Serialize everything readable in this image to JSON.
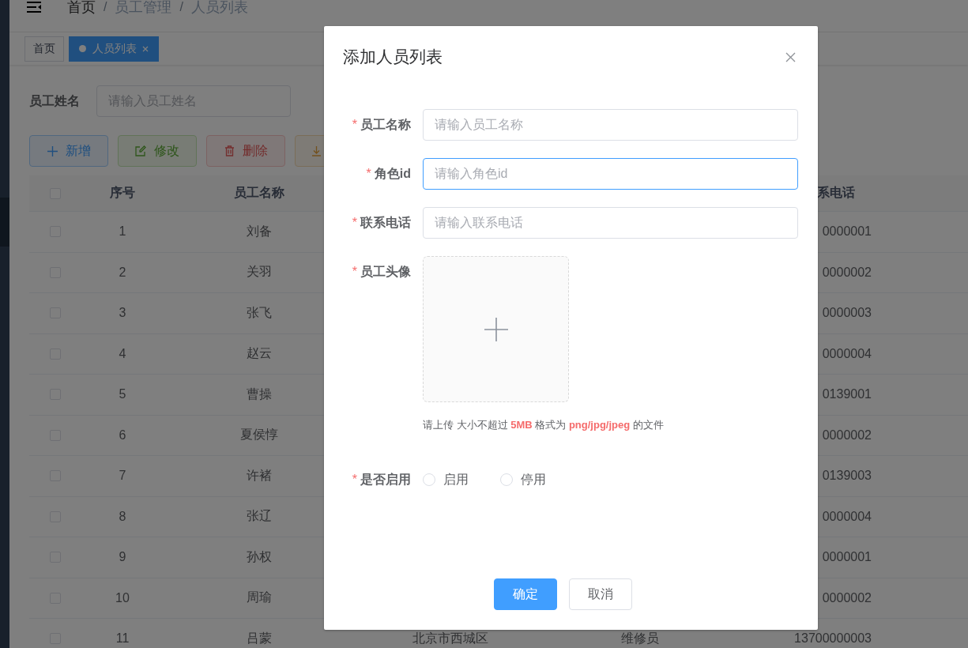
{
  "breadcrumb": [
    {
      "kind": "link",
      "text": "首页"
    },
    {
      "kind": "separator",
      "text": "/"
    },
    {
      "kind": "link",
      "text": "员工管理"
    },
    {
      "kind": "separator",
      "text": "/"
    },
    {
      "kind": "current",
      "text": "人员列表"
    }
  ],
  "tags": [
    {
      "label": "首页",
      "selected": false
    },
    {
      "label": "人员列表",
      "selected": true
    }
  ],
  "search": {
    "label": "员工姓名",
    "placeholder": "请输入员工姓名"
  },
  "toolbar": [
    {
      "kind": "add",
      "label": "新增"
    },
    {
      "kind": "edit",
      "label": "修改"
    },
    {
      "kind": "delete",
      "label": "删除"
    },
    {
      "kind": "export"
    }
  ],
  "table": {
    "select_all_checked": false,
    "header": {
      "no": "序号",
      "name": "员工名称",
      "phone": "系电话"
    },
    "rows": [
      {
        "checked": false,
        "no": "1",
        "name": "刘备",
        "phone": "0000001"
      },
      {
        "checked": false,
        "no": "2",
        "name": "关羽",
        "phone": "0000002"
      },
      {
        "checked": false,
        "no": "3",
        "name": "张飞",
        "phone": "0000003"
      },
      {
        "checked": false,
        "no": "4",
        "name": "赵云",
        "phone": "0000004"
      },
      {
        "checked": false,
        "no": "5",
        "name": "曹操",
        "phone": "0139001"
      },
      {
        "checked": false,
        "no": "6",
        "name": "夏侯惇",
        "phone": "0000002"
      },
      {
        "checked": false,
        "no": "7",
        "name": "许褚",
        "phone": "0139003"
      },
      {
        "checked": false,
        "no": "8",
        "name": "张辽",
        "phone": "0000004"
      },
      {
        "checked": false,
        "no": "9",
        "name": "孙权",
        "phone": "0000001"
      },
      {
        "checked": false,
        "no": "10",
        "name": "周瑜",
        "phone": "0000002"
      },
      {
        "checked": false,
        "no": "11",
        "name": "吕蒙",
        "column_4": "北京市西城区",
        "column_5": "维修员",
        "phone": "13700000003"
      }
    ]
  },
  "dialog": {
    "title": "添加人员列表",
    "fields": [
      {
        "kind": "text",
        "required_mark": "*",
        "label": "员工名称",
        "placeholder": "请输入员工名称",
        "focused": false
      },
      {
        "kind": "text",
        "required_mark": "*",
        "label": "角色id",
        "placeholder": "请输入角色id",
        "focused": true
      },
      {
        "kind": "text",
        "required_mark": "*",
        "label": "联系电话",
        "placeholder": "请输入联系电话",
        "focused": false
      },
      {
        "kind": "upload",
        "required_mark": "*",
        "label": "员工头像",
        "hint": "请上传 大小不超过 **5MB** 格式为 **png/jpg/jpeg** 的文件"
      },
      {
        "kind": "radio",
        "required_mark": "*",
        "label": "是否启用",
        "options": [
          {
            "label": "启用",
            "selected": false
          },
          {
            "label": "停用",
            "selected": false
          }
        ]
      }
    ],
    "buttons": [
      {
        "kind": "primary",
        "label": "确定"
      },
      {
        "kind": "default",
        "label": "取消"
      }
    ]
  }
}
